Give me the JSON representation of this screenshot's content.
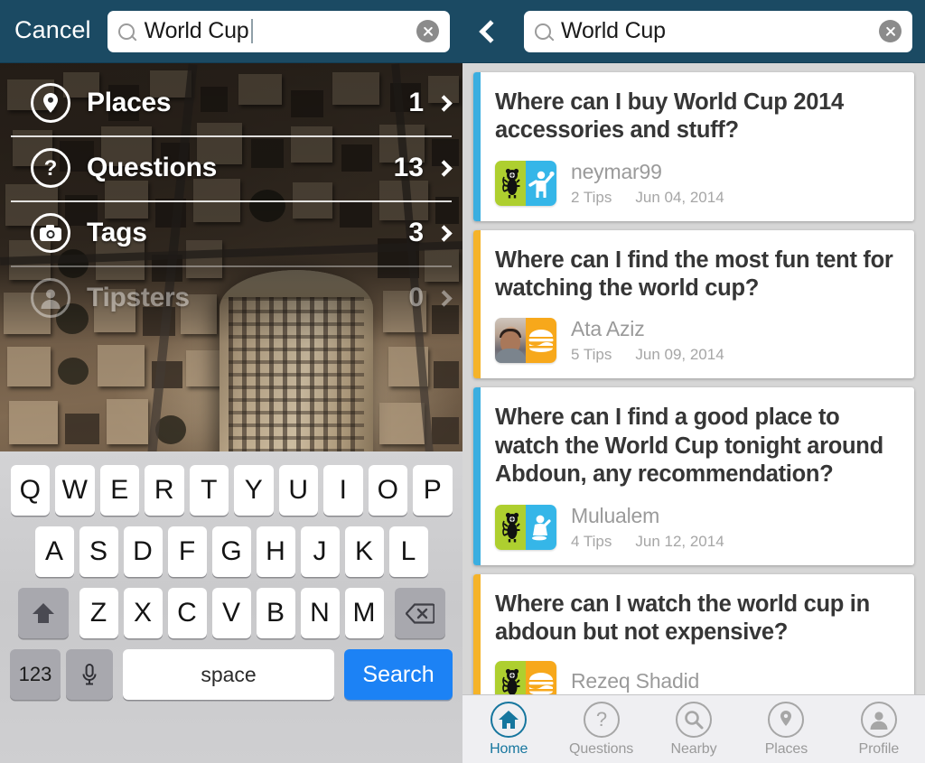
{
  "left": {
    "navbar": {
      "cancel_label": "Cancel",
      "search_value": "World Cup",
      "search_placeholder": "Search",
      "search_icon": "search-icon",
      "clear_icon": "clear-icon"
    },
    "menu": [
      {
        "label": "Places",
        "count": "1",
        "icon": "pin-icon",
        "disabled": false
      },
      {
        "label": "Questions",
        "count": "13",
        "icon": "question-icon",
        "disabled": false
      },
      {
        "label": "Tags",
        "count": "3",
        "icon": "camera-icon",
        "disabled": false
      },
      {
        "label": "Tipsters",
        "count": "0",
        "icon": "person-icon",
        "disabled": true
      }
    ],
    "keyboard": {
      "row1": [
        "Q",
        "W",
        "E",
        "R",
        "T",
        "Y",
        "U",
        "I",
        "O",
        "P"
      ],
      "row2": [
        "A",
        "S",
        "D",
        "F",
        "G",
        "H",
        "J",
        "K",
        "L"
      ],
      "row3": [
        "Z",
        "X",
        "C",
        "V",
        "B",
        "N",
        "M"
      ],
      "shift_icon": "shift-up-arrow-icon",
      "delete_icon": "backspace-icon",
      "numbers_label": "123",
      "mic_icon": "microphone-icon",
      "space_label": "space",
      "search_label": "Search"
    }
  },
  "right": {
    "navbar": {
      "back_icon": "back-chevron-icon",
      "search_value": "World Cup",
      "search_placeholder": "Search",
      "search_icon": "search-icon",
      "clear_icon": "clear-icon"
    },
    "cards": [
      {
        "title": "Where can I buy World Cup 2014 accessories and stuff?",
        "user": "neymar99",
        "tips": "2 Tips",
        "date": "Jun 04, 2014",
        "accent": "#3aaee0",
        "avatar_left": "animal-mascot-icon",
        "avatar_right": "person-cheering-icon",
        "avatar_left_color": "#aecf2f",
        "avatar_right_color": "#35b6e8"
      },
      {
        "title": "Where can I find the most fun tent for watching the world cup?",
        "user": "Ata Aziz",
        "tips": "5 Tips",
        "date": "Jun 09, 2014",
        "accent": "#f5b329",
        "avatar_left": "user-photo",
        "avatar_right": "burger-icon",
        "avatar_left_color": "#b6a596",
        "avatar_right_color": "#f7a81b"
      },
      {
        "title": "Where can I find a good place to watch the World Cup tonight around Abdoun, any recommendation?",
        "user": "Mulualem",
        "tips": "4 Tips",
        "date": "Jun 12, 2014",
        "accent": "#3aaee0",
        "avatar_left": "animal-mascot-icon",
        "avatar_right": "person-drinking-icon",
        "avatar_left_color": "#aecf2f",
        "avatar_right_color": "#35b6e8"
      },
      {
        "title": "Where can I watch the world cup in abdoun but not expensive?",
        "user": "Rezeq Shadid",
        "tips": "",
        "date": "",
        "accent": "#f5b329",
        "avatar_left": "animal-mascot-icon",
        "avatar_right": "burger-icon",
        "avatar_left_color": "#aecf2f",
        "avatar_right_color": "#f7a81b"
      }
    ],
    "tabs": [
      {
        "label": "Home",
        "icon": "home-icon",
        "active": true
      },
      {
        "label": "Questions",
        "icon": "question-icon",
        "active": false
      },
      {
        "label": "Nearby",
        "icon": "search-icon",
        "active": false
      },
      {
        "label": "Places",
        "icon": "pin-icon",
        "active": false
      },
      {
        "label": "Profile",
        "icon": "person-icon",
        "active": false
      }
    ]
  },
  "theme": {
    "navbar_color": "#1b4a63",
    "accent_blue": "#3aaee0",
    "accent_orange": "#f5b329",
    "tab_active_color": "#16769e",
    "keyboard_search_color": "#1c82f5"
  }
}
